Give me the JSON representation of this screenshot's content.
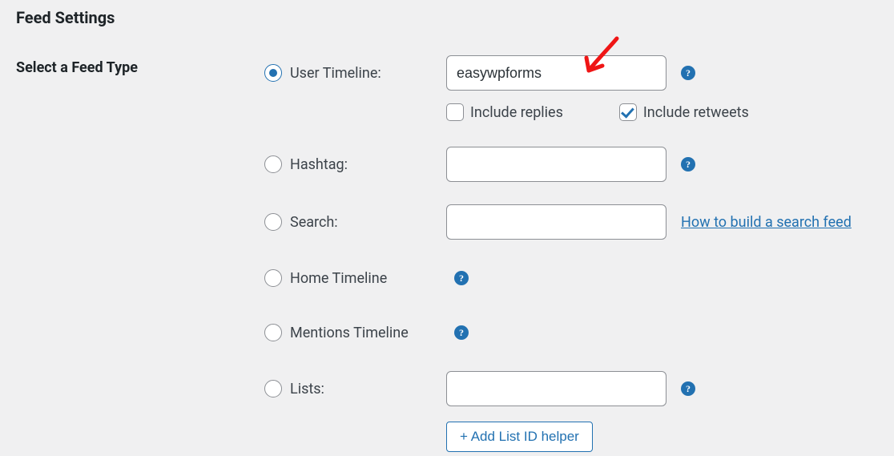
{
  "heading": "Feed Settings",
  "field_label": "Select a Feed Type",
  "options": {
    "user_timeline": {
      "label": "User Timeline:",
      "value": "easywpforms"
    },
    "hashtag": {
      "label": "Hashtag:",
      "value": ""
    },
    "search": {
      "label": "Search:",
      "value": ""
    },
    "home_timeline": {
      "label": "Home Timeline"
    },
    "mentions_timeline": {
      "label": "Mentions Timeline"
    },
    "lists": {
      "label": "Lists:",
      "value": ""
    }
  },
  "checkboxes": {
    "include_replies": {
      "label": "Include replies",
      "checked": false
    },
    "include_retweets": {
      "label": "Include retweets",
      "checked": true
    }
  },
  "links": {
    "search_howto": "How to build a search feed"
  },
  "buttons": {
    "list_helper": "+ Add List ID helper"
  },
  "help_glyph": "?"
}
